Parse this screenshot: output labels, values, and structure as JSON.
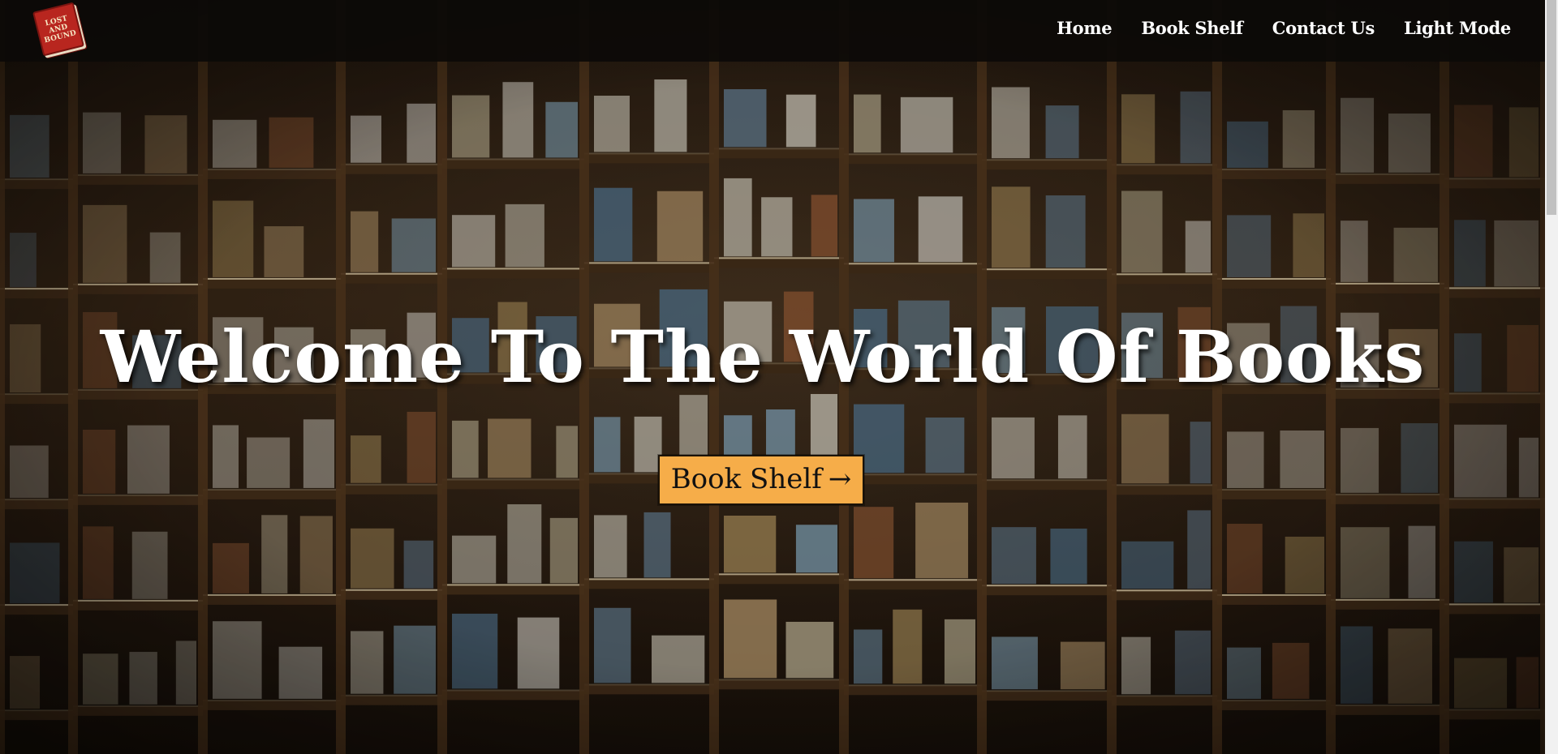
{
  "logo": {
    "text": "LOST AND BOUND",
    "lines": [
      "LOST",
      "AND",
      "BOUND"
    ]
  },
  "nav": {
    "items": [
      {
        "label": "Home"
      },
      {
        "label": "Book Shelf"
      },
      {
        "label": "Contact Us"
      },
      {
        "label": "Light Mode"
      }
    ]
  },
  "hero": {
    "title": "Welcome To The World Of Books",
    "button_label": "Book Shelf",
    "button_icon": "right-arrow-icon",
    "button_arrow": "→",
    "background": "bookshelf-photo"
  },
  "colors": {
    "navbar_bg": "#0c0a08",
    "accent_button": "#f6ad49",
    "title_text": "#ffffff"
  }
}
